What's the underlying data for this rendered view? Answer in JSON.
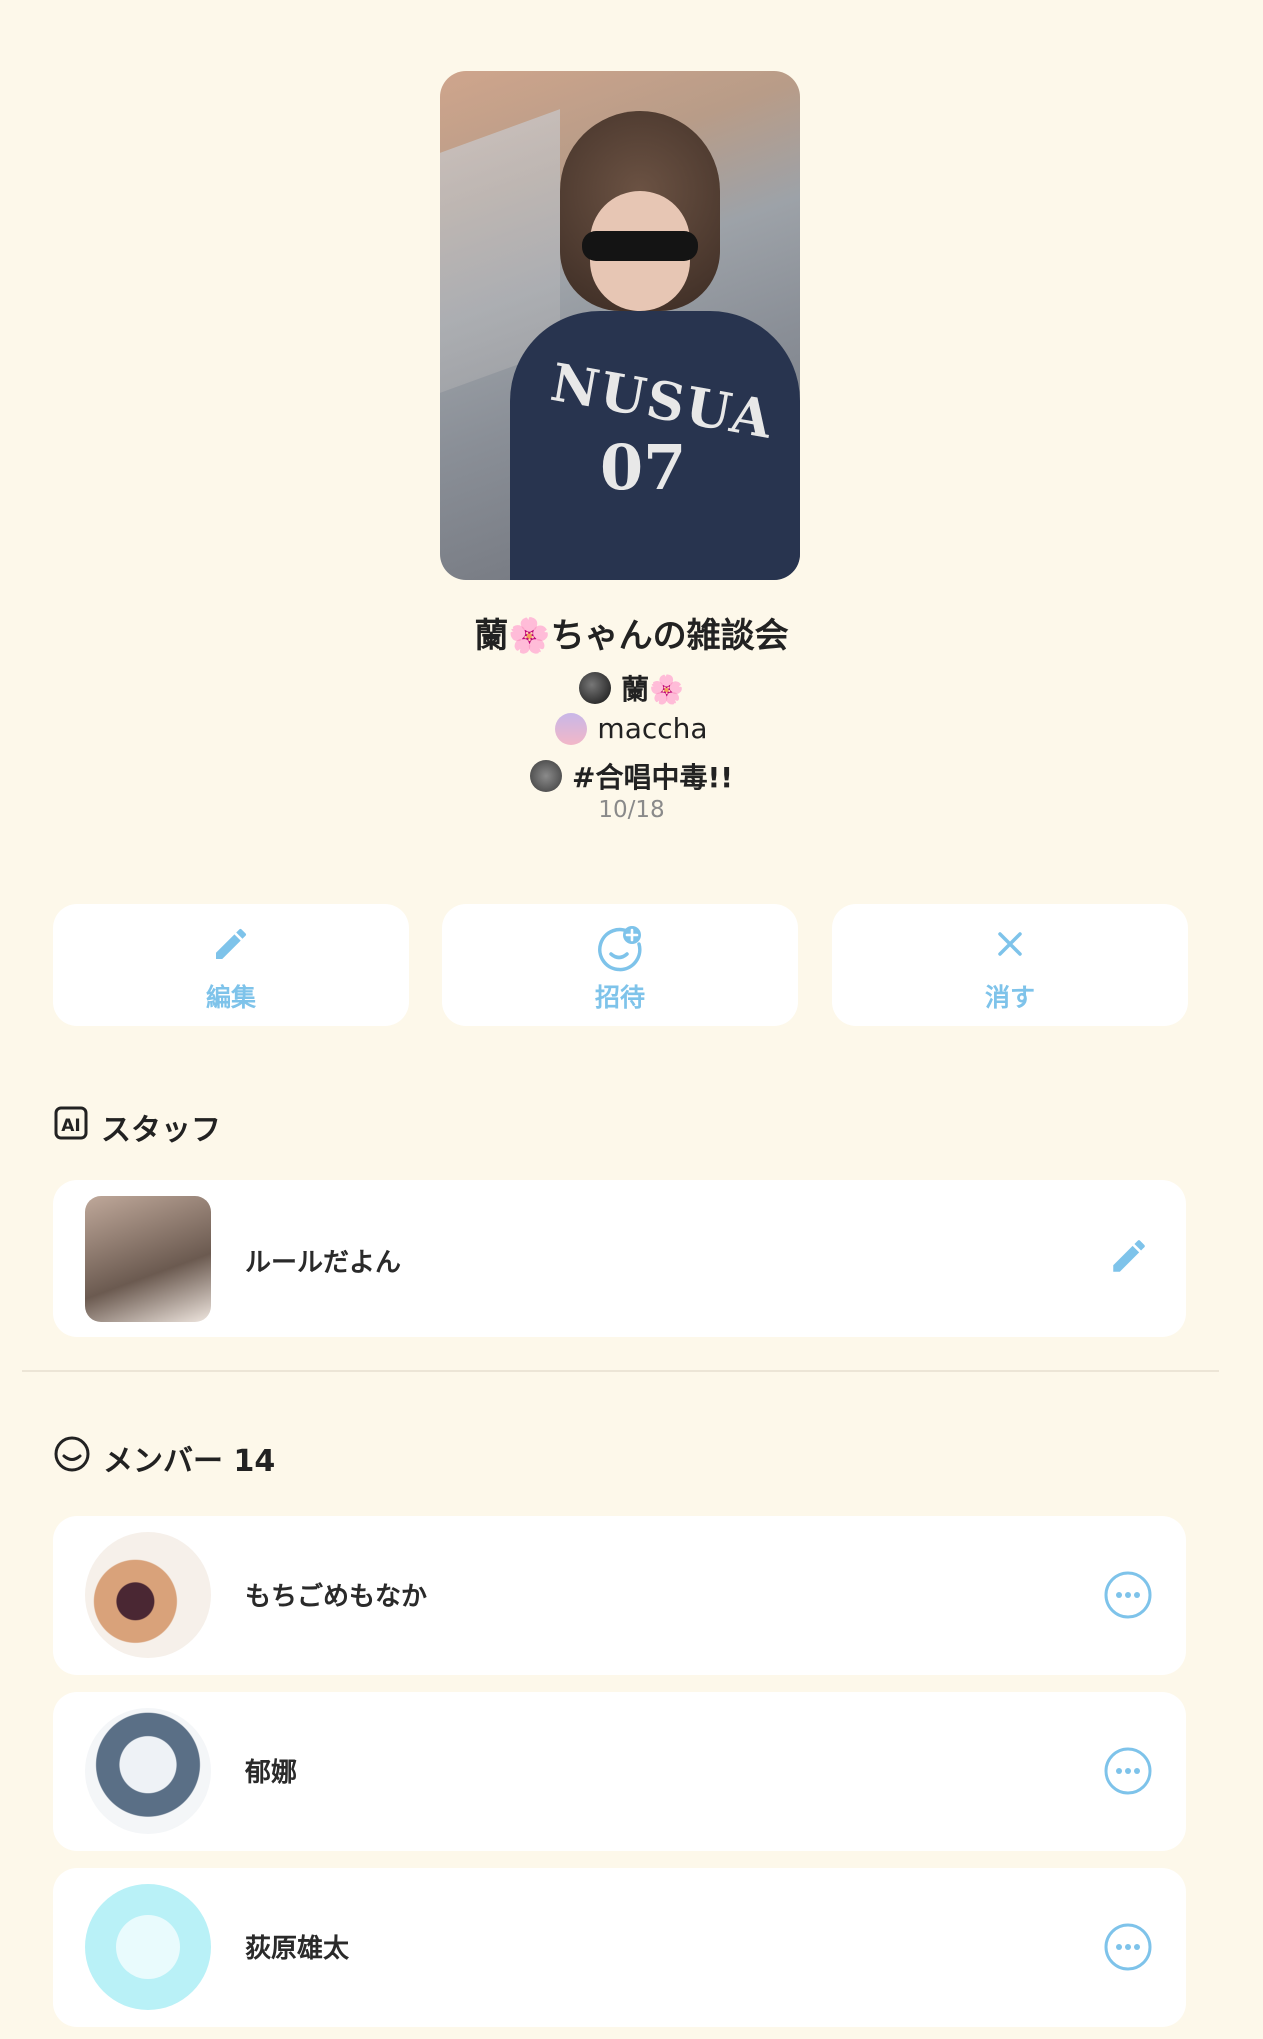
{
  "group": {
    "title": "蘭🌸ちゃんの雑談会",
    "owners": [
      "蘭🌸",
      "maccha",
      "#合唱中毒!!"
    ],
    "date": "10/18"
  },
  "cover_art": {
    "jersey_word": "NUSUA",
    "jersey_number": "07"
  },
  "actions": [
    {
      "label": "編集",
      "icon": "pencil-icon"
    },
    {
      "label": "招待",
      "icon": "add-person-icon"
    },
    {
      "label": "消す",
      "icon": "close-icon"
    }
  ],
  "staff": {
    "heading": "スタッフ",
    "icon": "ai-icon",
    "items": [
      {
        "name": "ルールだよん",
        "action_icon": "pencil-icon"
      }
    ]
  },
  "members": {
    "heading": "メンバー 14",
    "icon": "smile-icon",
    "items": [
      {
        "name": "もちごめもなか",
        "action_icon": "more-icon"
      },
      {
        "name": "郁娜",
        "action_icon": "more-icon"
      },
      {
        "name": "荻原雄太",
        "action_icon": "more-icon"
      }
    ]
  },
  "colors": {
    "background": "#fdf8ea",
    "accent": "#7ec3ea",
    "card": "#ffffff"
  }
}
